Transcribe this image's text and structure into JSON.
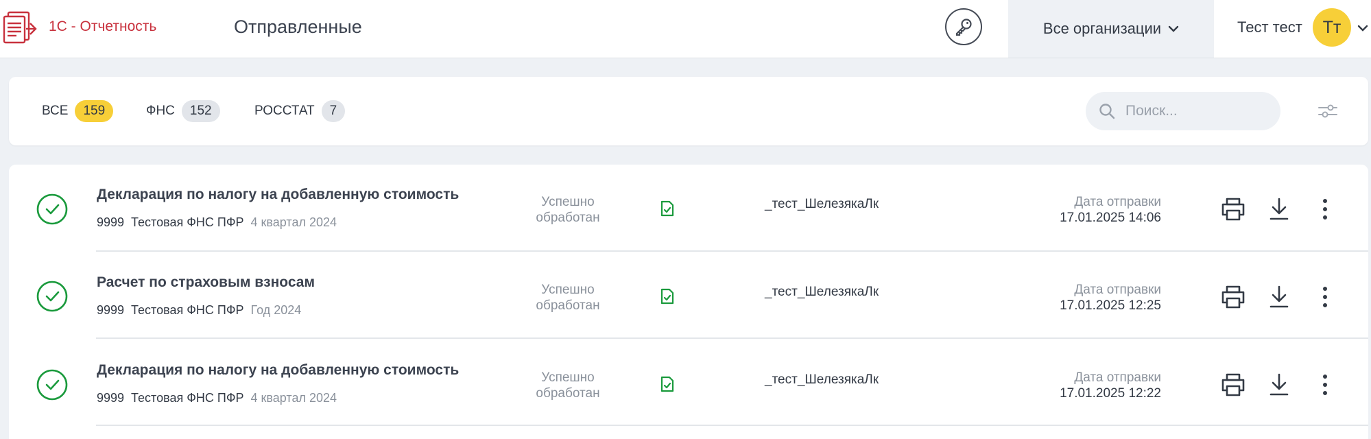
{
  "app": {
    "name": "1С - Отчетность"
  },
  "header": {
    "page_title": "Отправленные",
    "org_selector": "Все организации",
    "user_name": "Тест тест",
    "avatar_initials": "Тт"
  },
  "tabs": [
    {
      "label": "ВСЕ",
      "count": "159",
      "active": true
    },
    {
      "label": "ФНС",
      "count": "152",
      "active": false
    },
    {
      "label": "РОССТАТ",
      "count": "7",
      "active": false
    }
  ],
  "search": {
    "placeholder": "Поиск...",
    "value": ""
  },
  "rows": [
    {
      "title": "Декларация по налогу на добавленную стоимость",
      "code": "9999",
      "org": "Тестовая ФНС ПФР",
      "period": "4 квартал 2024",
      "status_line1": "Успешно",
      "status_line2": "обработан",
      "signer": "_тест_ШелезякаЛк",
      "date_label": "Дата отправки",
      "date_value": "17.01.2025 14:06"
    },
    {
      "title": "Расчет по страховым взносам",
      "code": "9999",
      "org": "Тестовая ФНС ПФР",
      "period": "Год 2024",
      "status_line1": "Успешно",
      "status_line2": "обработан",
      "signer": "_тест_ШелезякаЛк",
      "date_label": "Дата отправки",
      "date_value": "17.01.2025 12:25"
    },
    {
      "title": "Декларация по налогу на добавленную стоимость",
      "code": "9999",
      "org": "Тестовая ФНС ПФР",
      "period": "4 квартал 2024",
      "status_line1": "Успешно",
      "status_line2": "обработан",
      "signer": "_тест_ШелезякаЛк",
      "date_label": "Дата отправки",
      "date_value": "17.01.2025 12:22"
    }
  ],
  "icons": {
    "logo": "report-logo-icon",
    "key": "key-icon",
    "search": "search-icon",
    "filter": "filter-sliders-icon",
    "status": "check-circle-icon",
    "file": "document-check-icon",
    "print": "printer-icon",
    "download": "download-icon",
    "more": "more-vertical-icon"
  },
  "colors": {
    "brand": "#c8313d",
    "accent": "#f7cf38",
    "success": "#1a9a3c",
    "background": "#eef1f5"
  }
}
